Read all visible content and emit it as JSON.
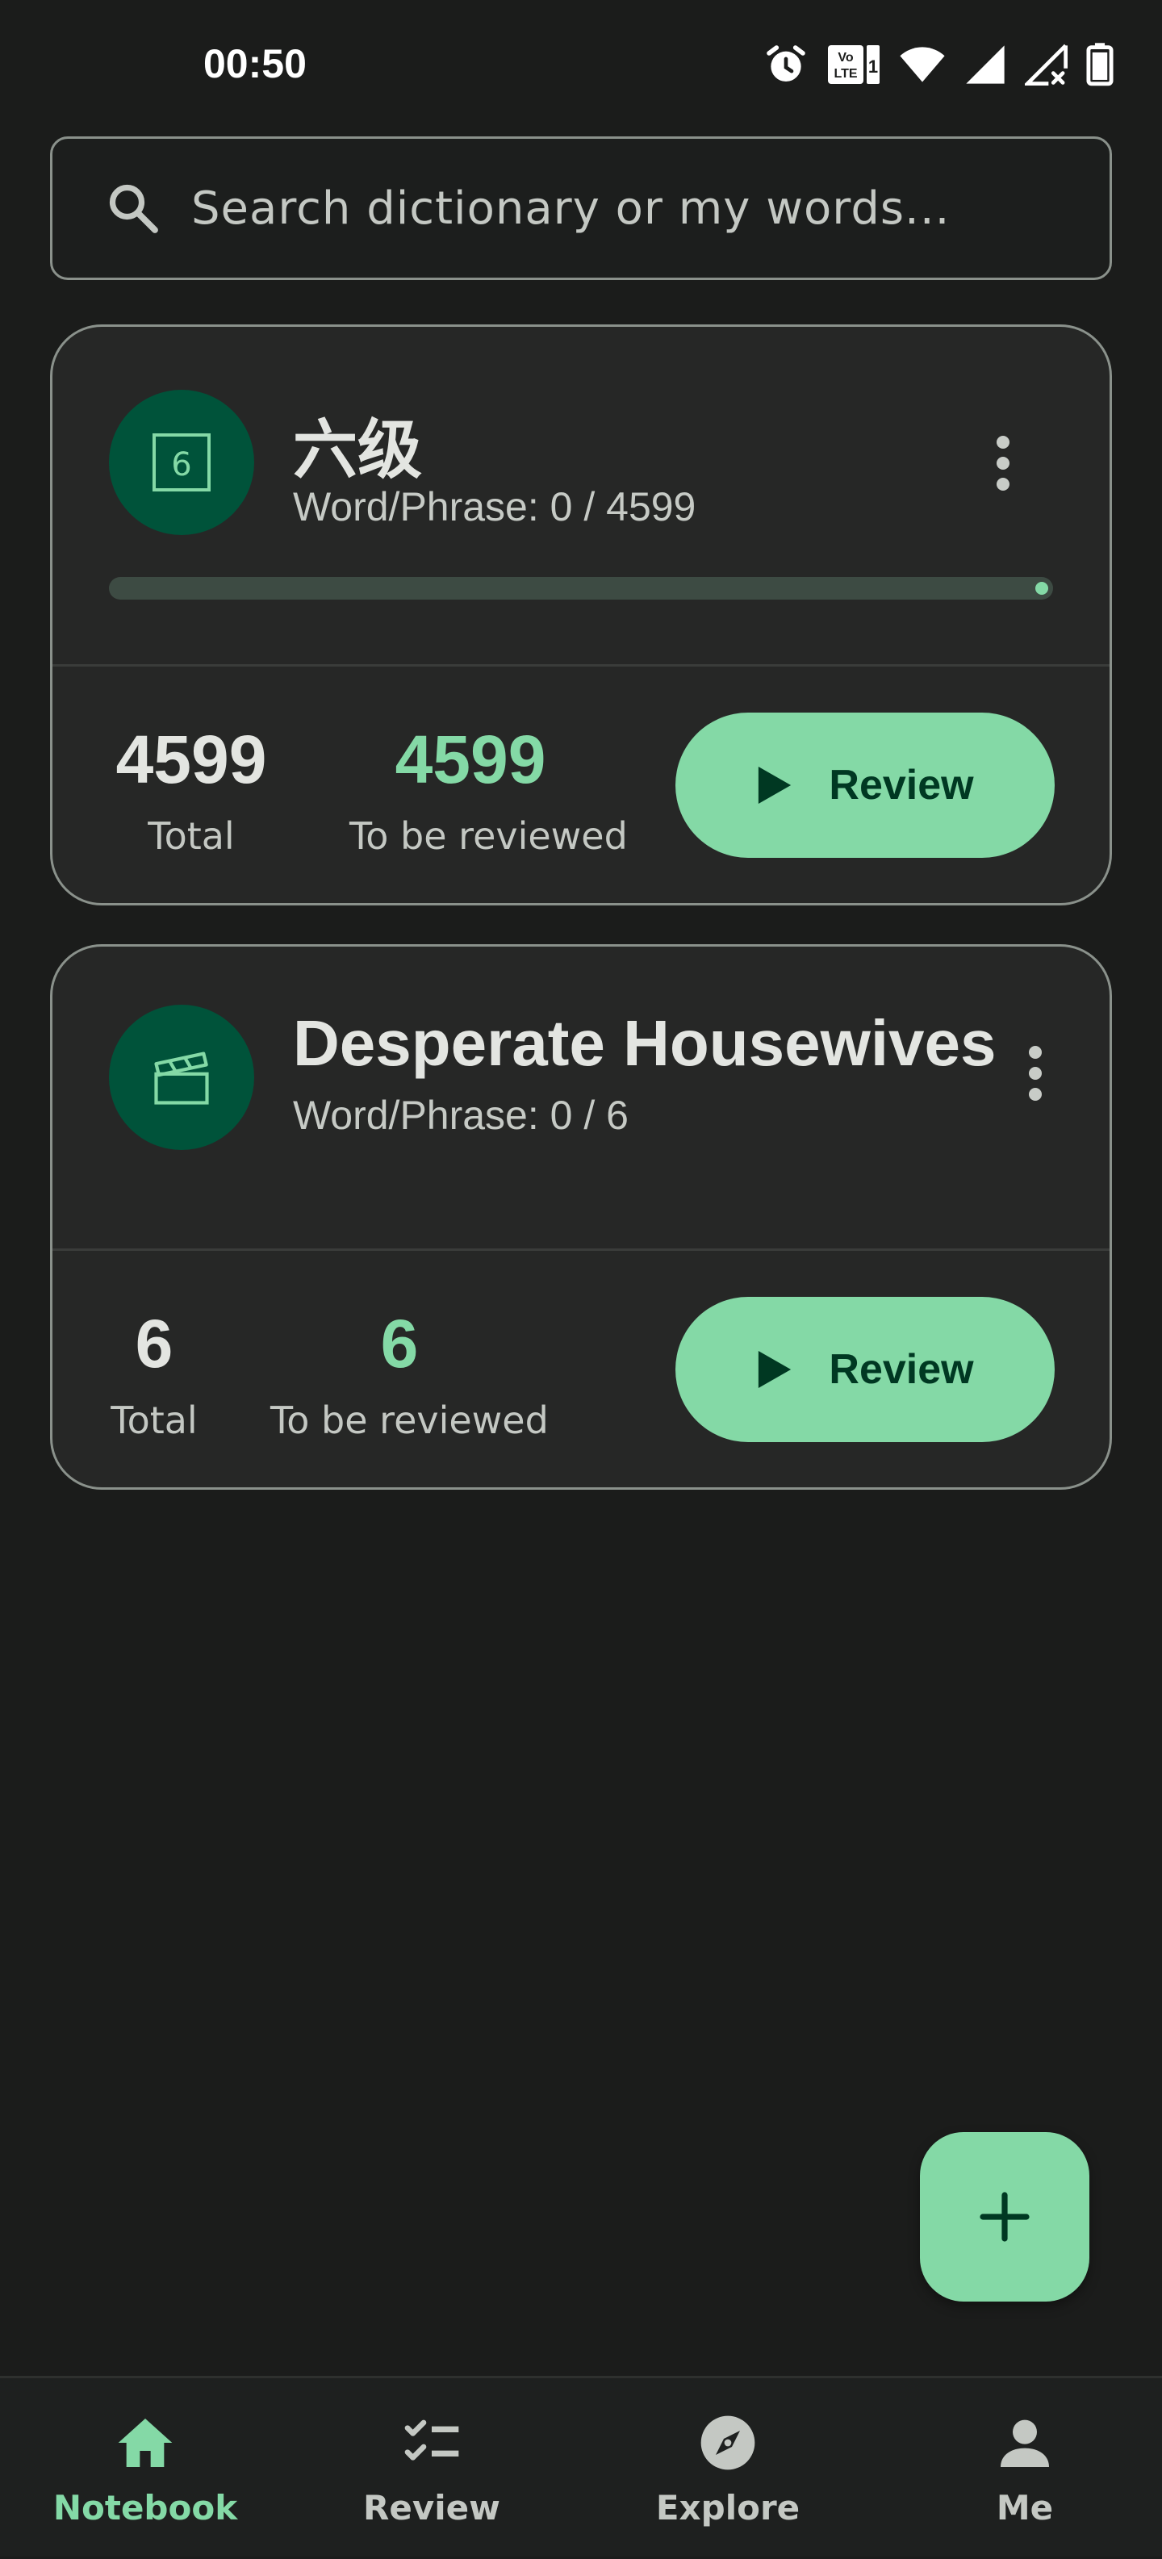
{
  "status_bar": {
    "time": "00:50"
  },
  "search": {
    "placeholder": "Search dictionary or my words..."
  },
  "notebooks": [
    {
      "title": "六级",
      "subtitle": "Word/Phrase: 0 / 4599",
      "icon": "six-square-icon",
      "progress": 0,
      "total": "4599",
      "total_label": "Total",
      "due": "4599",
      "due_label": "To be reviewed",
      "review_label": "Review"
    },
    {
      "title": "Desperate Housewives",
      "subtitle": "Word/Phrase: 0 / 6",
      "icon": "clapperboard-icon",
      "total": "6",
      "total_label": "Total",
      "due": "6",
      "due_label": "To be reviewed",
      "review_label": "Review"
    }
  ],
  "fab": {
    "icon": "plus-icon"
  },
  "bottom_nav": {
    "active": "Notebook",
    "items": [
      {
        "label": "Notebook",
        "icon": "home-icon"
      },
      {
        "label": "Review",
        "icon": "checklist-icon"
      },
      {
        "label": "Explore",
        "icon": "compass-icon"
      },
      {
        "label": "Me",
        "icon": "person-icon"
      }
    ]
  },
  "colors": {
    "background": "#1b1c1b",
    "card": "#262726",
    "accent": "#84d9a6",
    "avatar_bg": "#00533a",
    "on_accent": "#003822"
  }
}
